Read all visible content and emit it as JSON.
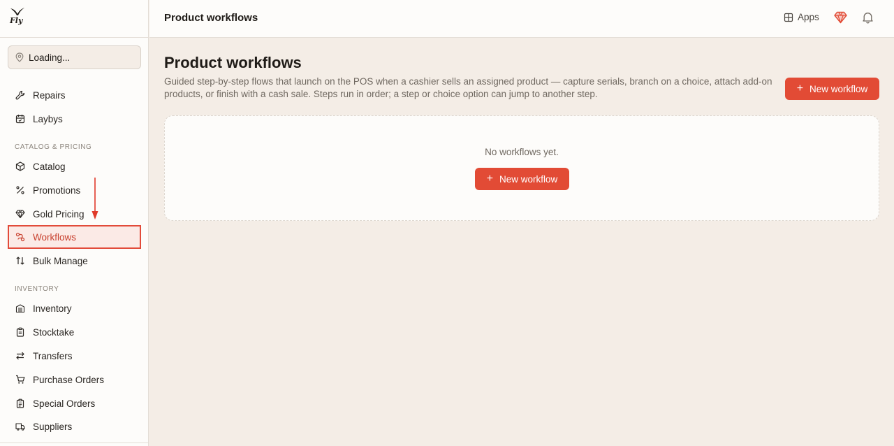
{
  "brand": {
    "name": "Fly"
  },
  "sidebar": {
    "location": "Loading...",
    "items_top": [
      {
        "label": "Repairs",
        "icon": "wrench-icon"
      },
      {
        "label": "Laybys",
        "icon": "calendar-icon"
      }
    ],
    "catalog_section": "CATALOG & PRICING",
    "catalog_items": [
      {
        "label": "Catalog",
        "icon": "package-icon"
      },
      {
        "label": "Promotions",
        "icon": "percent-icon"
      },
      {
        "label": "Gold Pricing",
        "icon": "gem-icon"
      },
      {
        "label": "Workflows",
        "icon": "workflow-icon",
        "active": true
      },
      {
        "label": "Bulk Manage",
        "icon": "arrows-updown-icon"
      }
    ],
    "inventory_section": "INVENTORY",
    "inventory_items": [
      {
        "label": "Inventory",
        "icon": "warehouse-icon"
      },
      {
        "label": "Stocktake",
        "icon": "clipboard-icon"
      },
      {
        "label": "Transfers",
        "icon": "transfer-icon"
      },
      {
        "label": "Purchase Orders",
        "icon": "cart-icon"
      },
      {
        "label": "Special Orders",
        "icon": "clipboard-list-icon"
      },
      {
        "label": "Suppliers",
        "icon": "truck-icon"
      }
    ]
  },
  "header": {
    "title": "Product workflows",
    "apps_label": "Apps"
  },
  "main": {
    "title": "Product workflows",
    "description": "Guided step-by-step flows that launch on the POS when a cashier sells an assigned product — capture serials, branch on a choice, attach add-on products, or finish with a cash sale. Steps run in order; a step or choice option can jump to another step.",
    "new_button_label": "New workflow",
    "empty_text": "No workflows yet.",
    "empty_button_label": "New workflow"
  },
  "colors": {
    "accent": "#e24b35",
    "highlight_border": "#e24b3a",
    "background": "#f4ede6"
  }
}
